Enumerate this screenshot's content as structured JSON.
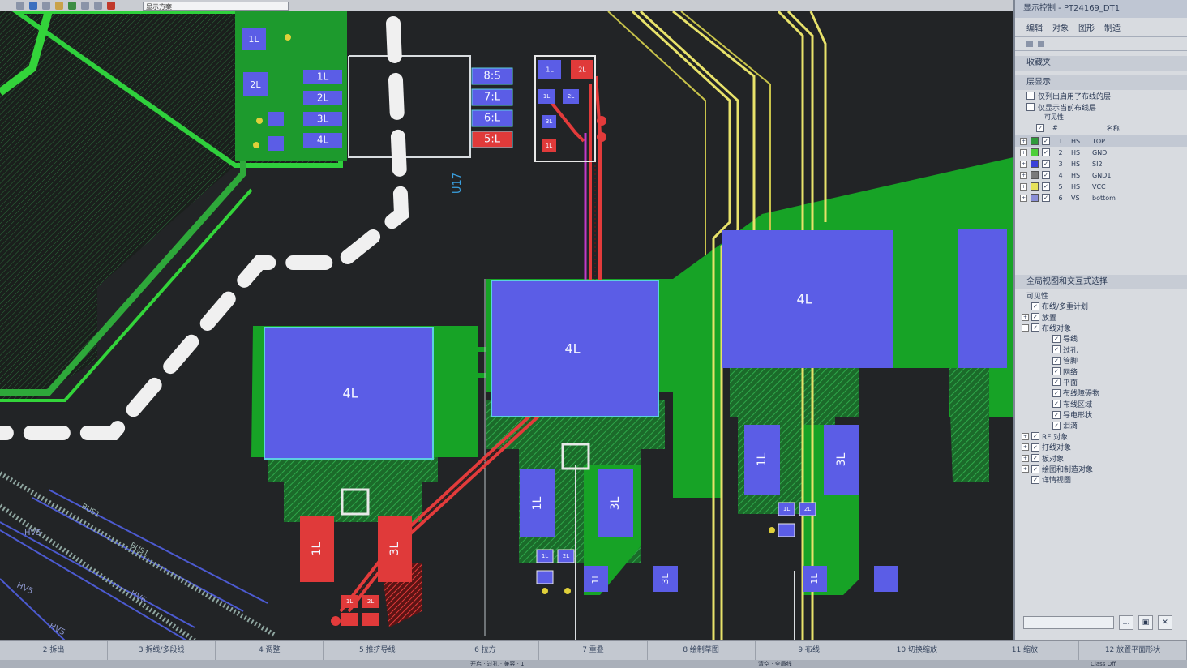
{
  "toolbar": {
    "scheme_select": "显示方案"
  },
  "panel": {
    "title": "显示控制 - PT24169_DT1",
    "tabs": [
      "编辑",
      "对象",
      "图形",
      "制造"
    ],
    "favorites": "收藏夹",
    "layer_display": "层显示",
    "only_routed": "仅列出启用了布线的层",
    "only_current": "仅显示当前布线层",
    "visible_label": "可见性",
    "col_num": "#",
    "col_name": "名称",
    "layers": [
      {
        "num": "1",
        "type": "HS",
        "name": "TOP",
        "color": "#2f9a3a"
      },
      {
        "num": "2",
        "type": "HS",
        "name": "GND",
        "color": "#4ccf3a"
      },
      {
        "num": "3",
        "type": "HS",
        "name": "SI2",
        "color": "#3a41d9"
      },
      {
        "num": "4",
        "type": "HS",
        "name": "GND1",
        "color": "#7a7a7a"
      },
      {
        "num": "5",
        "type": "HS",
        "name": "VCC",
        "color": "#e7e25a"
      },
      {
        "num": "6",
        "type": "VS",
        "name": "bottom",
        "color": "#8a8fd6"
      }
    ],
    "global_view": "全局视图和交互式选择",
    "visibility": "可见性",
    "tree": [
      {
        "label": "布线/多重计划",
        "level": 1,
        "exp": ""
      },
      {
        "label": "放置",
        "level": 1,
        "exp": "+"
      },
      {
        "label": "布线对象",
        "level": 1,
        "exp": "-"
      },
      {
        "label": "导线",
        "level": 2,
        "exp": ""
      },
      {
        "label": "过孔",
        "level": 2,
        "exp": ""
      },
      {
        "label": "管脚",
        "level": 2,
        "exp": ""
      },
      {
        "label": "网络",
        "level": 2,
        "exp": ""
      },
      {
        "label": "平面",
        "level": 2,
        "exp": ""
      },
      {
        "label": "布线障碍物",
        "level": 2,
        "exp": ""
      },
      {
        "label": "布线区域",
        "level": 2,
        "exp": ""
      },
      {
        "label": "导电形状",
        "level": 2,
        "exp": ""
      },
      {
        "label": "泪滴",
        "level": 2,
        "exp": ""
      },
      {
        "label": "RF 对象",
        "level": 1,
        "exp": "+"
      },
      {
        "label": "打线对象",
        "level": 1,
        "exp": "+"
      },
      {
        "label": "板对象",
        "level": 1,
        "exp": "+"
      },
      {
        "label": "绘图和制造对象",
        "level": 1,
        "exp": "+"
      },
      {
        "label": "详情视图",
        "level": 1,
        "exp": ""
      }
    ]
  },
  "canvas": {
    "refdes": "U17",
    "pads": {
      "top_left": [
        "1L",
        "2L"
      ],
      "small_col": [
        "1L",
        "2L",
        "3L",
        "4L"
      ],
      "mid_col": [
        "8:S",
        "7:L",
        "6:L",
        "5:L"
      ],
      "tiny": [
        "1L",
        "2L",
        "1L",
        "2L",
        "3L",
        "1L"
      ],
      "big": [
        "4L",
        "4L",
        "4L"
      ],
      "bottom": [
        "1L",
        "3L",
        "1L",
        "3L",
        "1L",
        "3L",
        "1L",
        "3L",
        "1L"
      ],
      "micro": [
        "1L",
        "2L",
        "1L",
        "2L",
        "1L",
        "2L"
      ]
    },
    "nets": [
      "HV5",
      "HV5",
      "HV6",
      "HV5",
      "BUS1",
      "BUS1"
    ]
  },
  "fkeys": [
    "2 拆出",
    "3 拆线/多段线",
    "4 调整",
    "5 推挤导线",
    "6 拉方",
    "7 重叠",
    "8 绘制草图",
    "9 布线",
    "10 切换缩放",
    "11 缩放",
    "12 放置平面形状"
  ],
  "status": {
    "left": "开启 · 过孔 · 兼容 · 1",
    "middle": "清空 · 全局线",
    "right": "Class Off"
  }
}
